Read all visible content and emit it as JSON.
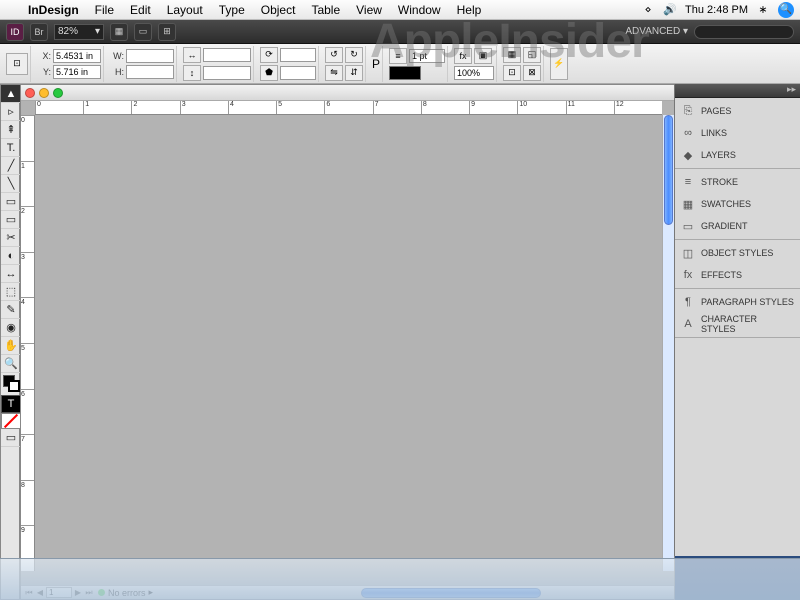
{
  "menubar": {
    "app_name": "InDesign",
    "items": [
      "File",
      "Edit",
      "Layout",
      "Type",
      "Object",
      "Table",
      "View",
      "Window",
      "Help"
    ],
    "clock": "Thu 2:48 PM"
  },
  "appbar": {
    "id_label": "ID",
    "br_label": "Br",
    "zoom": "82%",
    "workspace": "ADVANCED ▾"
  },
  "ctrlbar": {
    "x_label": "X:",
    "x_val": "5.4531 in",
    "y_label": "Y:",
    "y_val": "5.716 in",
    "w_label": "W:",
    "w_val": "",
    "h_label": "H:",
    "h_val": "",
    "stroke_label": "1 pt",
    "opacity": "100%"
  },
  "ruler_h": [
    "0",
    "1",
    "2",
    "3",
    "4",
    "5",
    "6",
    "7",
    "8",
    "9",
    "10",
    "11",
    "12"
  ],
  "ruler_v": [
    "0",
    "1",
    "2",
    "3",
    "4",
    "5",
    "6",
    "7",
    "8",
    "9"
  ],
  "statusbar": {
    "page": "1",
    "errors": "No errors"
  },
  "panels": {
    "g1": [
      {
        "icon": "⎘",
        "label": "PAGES"
      },
      {
        "icon": "∞",
        "label": "LINKS"
      },
      {
        "icon": "◆",
        "label": "LAYERS"
      }
    ],
    "g2": [
      {
        "icon": "≡",
        "label": "STROKE"
      },
      {
        "icon": "▦",
        "label": "SWATCHES"
      },
      {
        "icon": "▭",
        "label": "GRADIENT"
      }
    ],
    "g3": [
      {
        "icon": "◫",
        "label": "OBJECT STYLES"
      },
      {
        "icon": "fx",
        "label": "EFFECTS"
      }
    ],
    "g4": [
      {
        "icon": "¶",
        "label": "PARAGRAPH STYLES"
      },
      {
        "icon": "A",
        "label": "CHARACTER STYLES"
      }
    ]
  },
  "tools": [
    "▲",
    "▹",
    "⇞",
    "T.",
    "╱",
    "╲",
    "▭",
    "▭",
    "✂",
    "◐",
    "↔",
    "⬚",
    "✎",
    "◉",
    "✋",
    "🔍"
  ],
  "watermark": "AppleInsider"
}
